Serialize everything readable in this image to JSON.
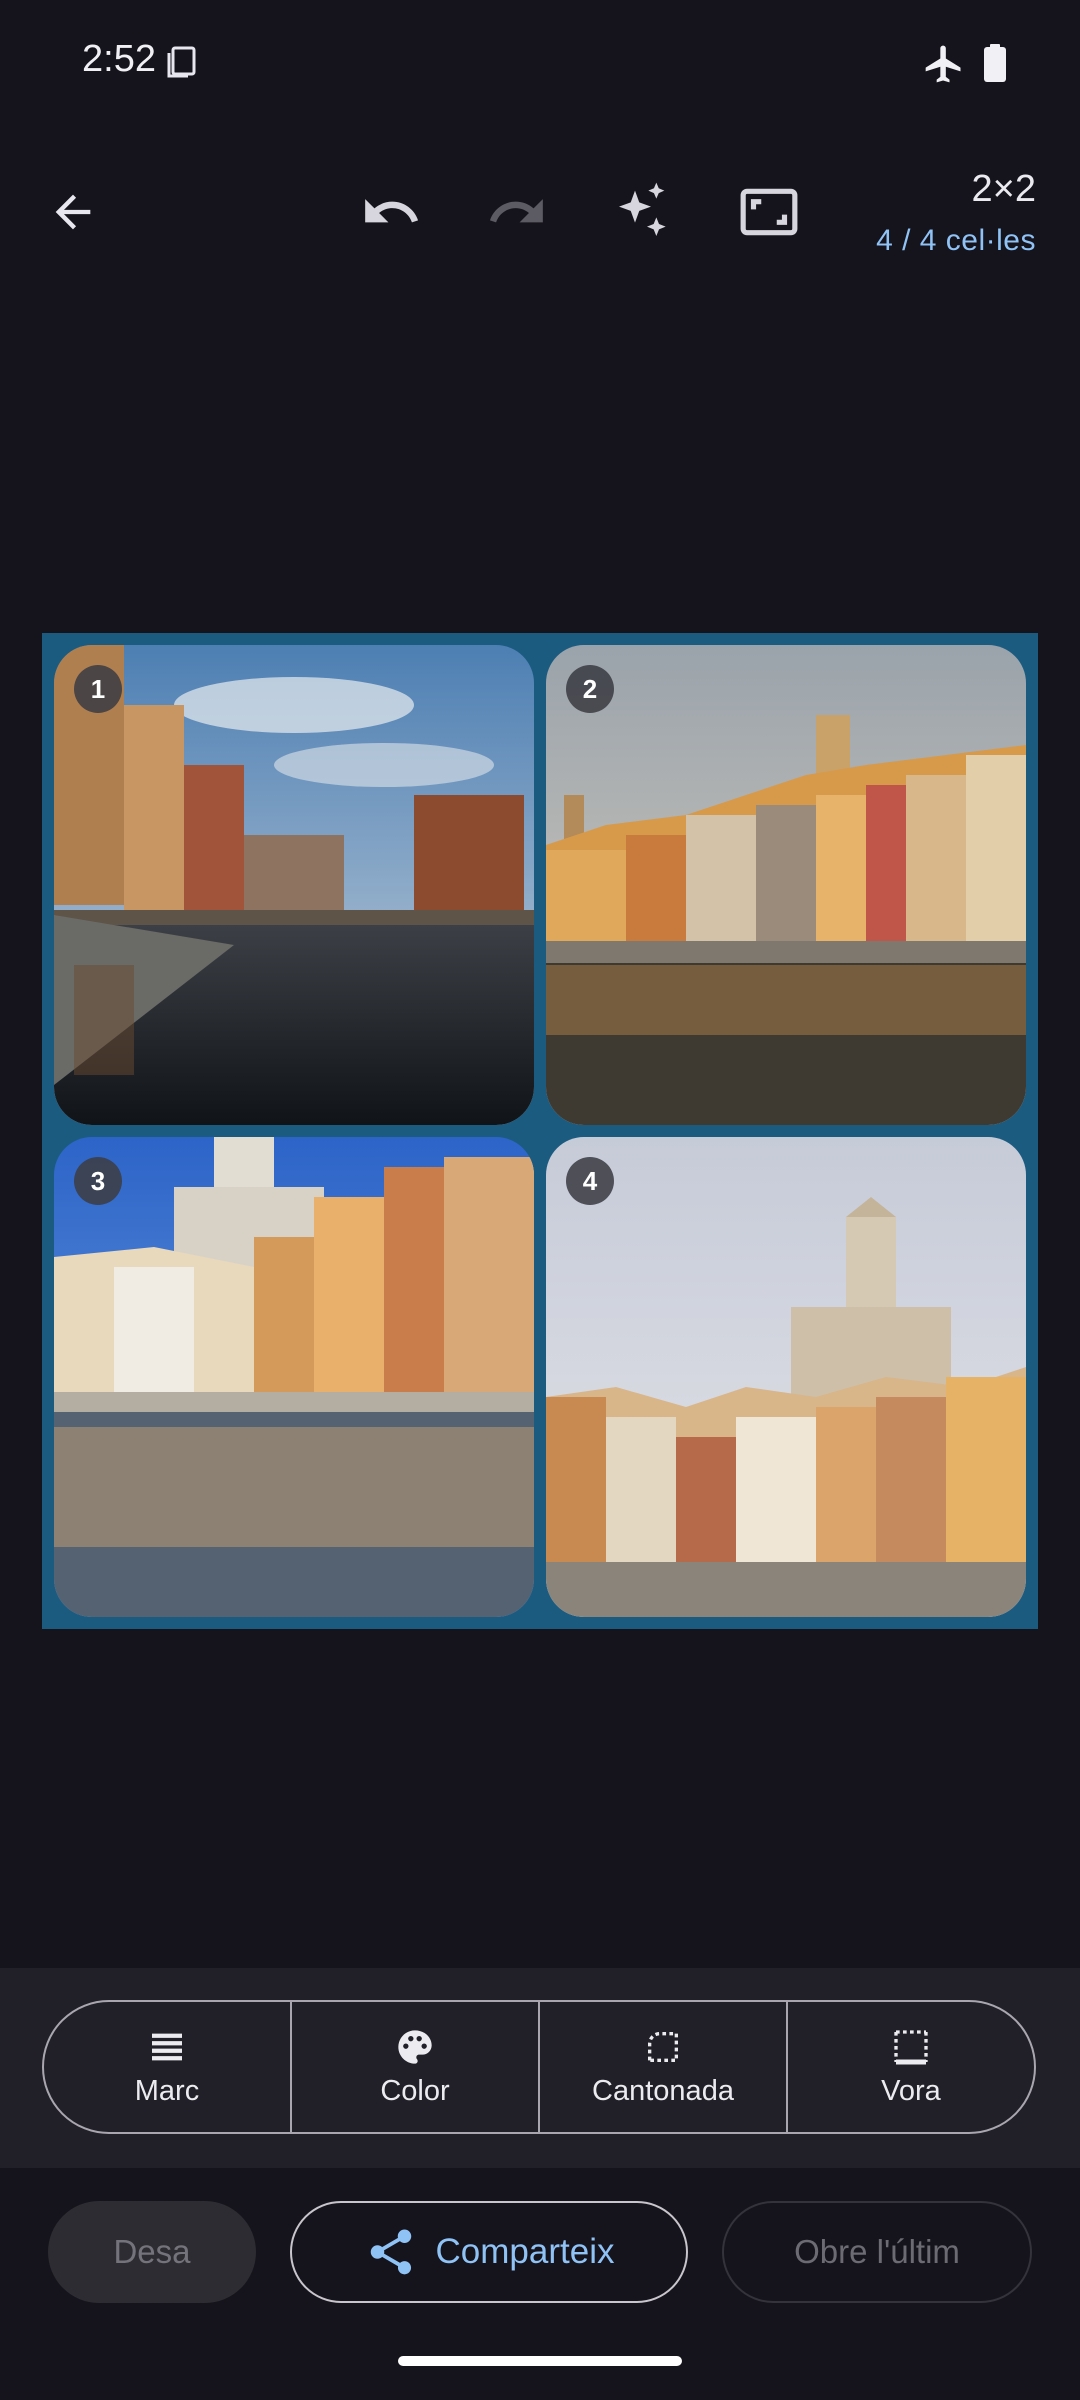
{
  "status_bar": {
    "time": "2:52",
    "icons": [
      "screenshot-icon",
      "airplane-mode-icon",
      "battery-full-icon"
    ]
  },
  "toolbar": {
    "icons": [
      "arrow-back-icon",
      "undo-icon",
      "redo-icon",
      "sparkle-icon",
      "fit-screen-icon"
    ],
    "redo_enabled": false,
    "grid_size": "2×2",
    "cell_count": "4 / 4 cel·les"
  },
  "collage": {
    "frame_color": "#1b5b80",
    "cells": [
      {
        "badge": "1"
      },
      {
        "badge": "2"
      },
      {
        "badge": "3"
      },
      {
        "badge": "4"
      }
    ]
  },
  "tools": [
    {
      "label": "Marc",
      "icon": "lines-icon"
    },
    {
      "label": "Color",
      "icon": "palette-icon"
    },
    {
      "label": "Cantonada",
      "icon": "rounded-corner-icon"
    },
    {
      "label": "Vora",
      "icon": "border-icon"
    }
  ],
  "actions": {
    "save_label": "Desa",
    "share_label": "Comparteix",
    "open_last_label": "Obre l'últim"
  },
  "colors": {
    "background": "#15131b",
    "accent": "#8fc2f5"
  }
}
